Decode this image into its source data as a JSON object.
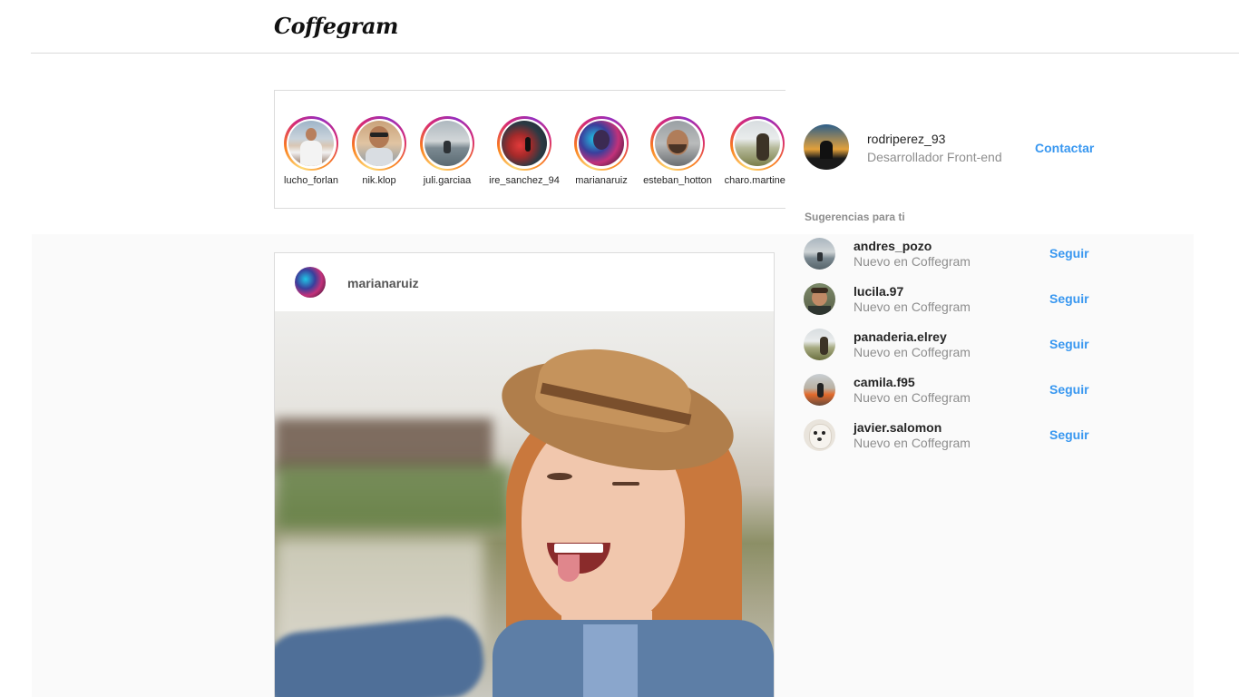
{
  "header": {
    "logo": "Coffegram"
  },
  "stories": [
    {
      "username": "lucho_forlan",
      "avatar": "man-white-shirt-mountains"
    },
    {
      "username": "nik.klop",
      "avatar": "man-sunglasses"
    },
    {
      "username": "juli.garciaa",
      "avatar": "person-on-dock-lake"
    },
    {
      "username": "ire_sanchez_94",
      "avatar": "woman-with-red-smoke"
    },
    {
      "username": "marianaruiz",
      "avatar": "woman-neon-light"
    },
    {
      "username": "esteban_hotton",
      "avatar": "smiling-man-beard"
    },
    {
      "username": "charo.martinez",
      "avatar": "woman-by-lake"
    }
  ],
  "post": {
    "username": "marianaruiz",
    "image": "smiling-woman-straw-hat-selfie"
  },
  "profile": {
    "username": "rodriperez_93",
    "bio": "Desarrollador Front-end",
    "contact_label": "Contactar"
  },
  "suggestions": {
    "title": "Sugerencias para ti",
    "items": [
      {
        "username": "andres_pozo",
        "subtitle": "Nuevo en Coffegram",
        "follow_label": "Seguir"
      },
      {
        "username": "lucila.97",
        "subtitle": "Nuevo en Coffegram",
        "follow_label": "Seguir"
      },
      {
        "username": "panaderia.elrey",
        "subtitle": "Nuevo en Coffegram",
        "follow_label": "Seguir"
      },
      {
        "username": "camila.f95",
        "subtitle": "Nuevo en Coffegram",
        "follow_label": "Seguir"
      },
      {
        "username": "javier.salomon",
        "subtitle": "Nuevo en Coffegram",
        "follow_label": "Seguir"
      }
    ]
  },
  "colors": {
    "accent": "#3897f0",
    "muted": "#8e8e8e",
    "border": "#dbdbdb"
  }
}
